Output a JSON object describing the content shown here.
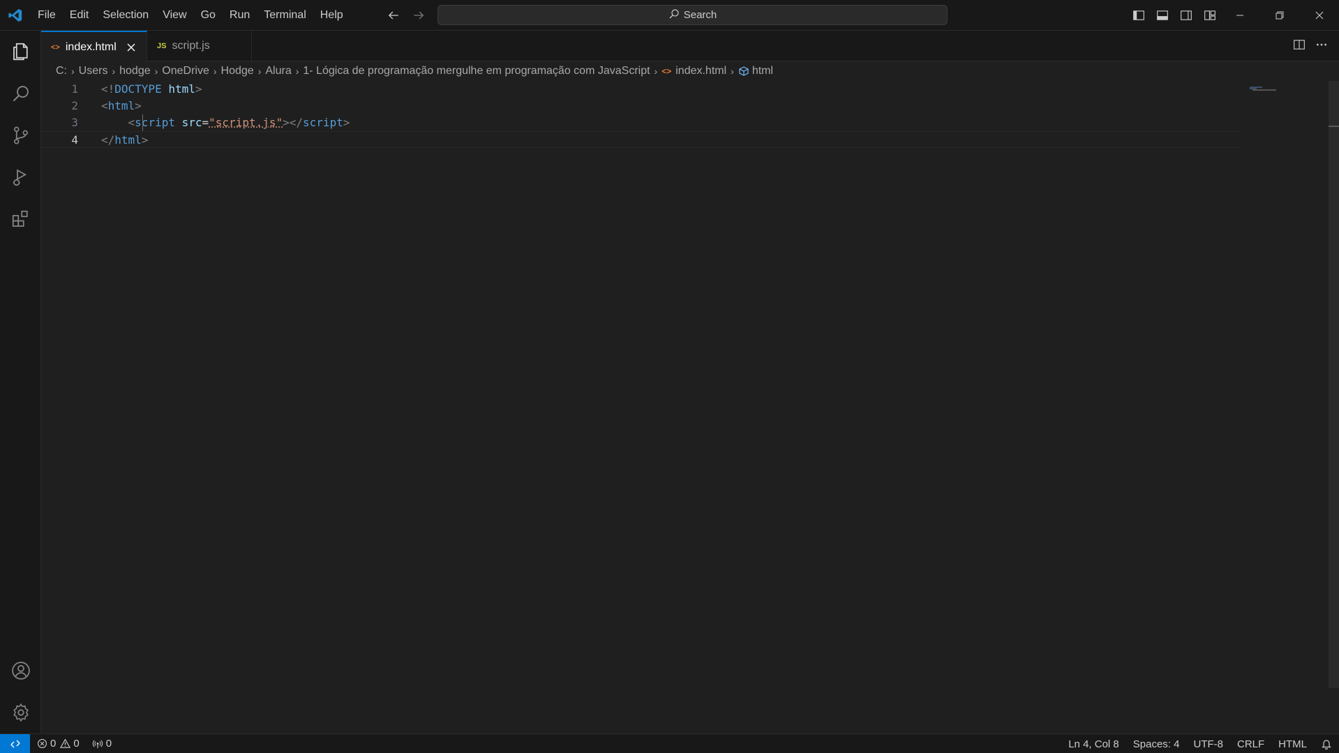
{
  "menu": [
    "File",
    "Edit",
    "Selection",
    "View",
    "Go",
    "Run",
    "Terminal",
    "Help"
  ],
  "search": {
    "label": "Search"
  },
  "tabs": [
    {
      "label": "index.html",
      "icon": "<>",
      "active": true
    },
    {
      "label": "script.js",
      "icon": "JS",
      "active": false
    }
  ],
  "breadcrumb": [
    "C:",
    "Users",
    "hodge",
    "OneDrive",
    "Hodge",
    "Alura",
    "1- Lógica de programação mergulhe em programação com JavaScript",
    "index.html",
    "html"
  ],
  "editor": {
    "line_numbers": [
      "1",
      "2",
      "3",
      "4"
    ],
    "lines": {
      "l1_open": "<!",
      "l1_doctype": "DOCTYPE",
      "l1_html": "html",
      "l1_close": ">",
      "l2_open": "<",
      "l2_name": "html",
      "l2_close": ">",
      "l3_indent": "    ",
      "l3_open": "<",
      "l3_name": "script",
      "l3_attr": "src",
      "l3_eq": "=",
      "l3_str": "\"script.js\"",
      "l3_mid": "></",
      "l3_name2": "script",
      "l3_close": ">",
      "l4_open": "</",
      "l4_name": "html",
      "l4_close": ">"
    }
  },
  "status": {
    "errors": "0",
    "warnings": "0",
    "ports": "0",
    "position": "Ln 4, Col 8",
    "spaces": "Spaces: 4",
    "encoding": "UTF-8",
    "eol": "CRLF",
    "language": "HTML"
  },
  "colors": {
    "accent": "#0078d4",
    "tag": "#569cd6",
    "attr": "#9cdcfe",
    "string": "#ce9178",
    "html_icon": "#e37933",
    "js_icon": "#cbcb41"
  },
  "icons": [
    "vscode-logo-icon",
    "arrow-left-icon",
    "arrow-right-icon",
    "search-icon",
    "toggle-sidebar-icon",
    "toggle-panel-icon",
    "toggle-secondary-sidebar-icon",
    "customize-layout-icon",
    "minimize-icon",
    "restore-icon",
    "close-icon",
    "explorer-icon",
    "search-view-icon",
    "source-control-icon",
    "run-debug-icon",
    "extensions-icon",
    "accounts-icon",
    "settings-gear-icon",
    "split-editor-icon",
    "more-actions-icon",
    "remote-icon",
    "error-icon",
    "warning-icon",
    "ports-icon",
    "bell-icon"
  ]
}
